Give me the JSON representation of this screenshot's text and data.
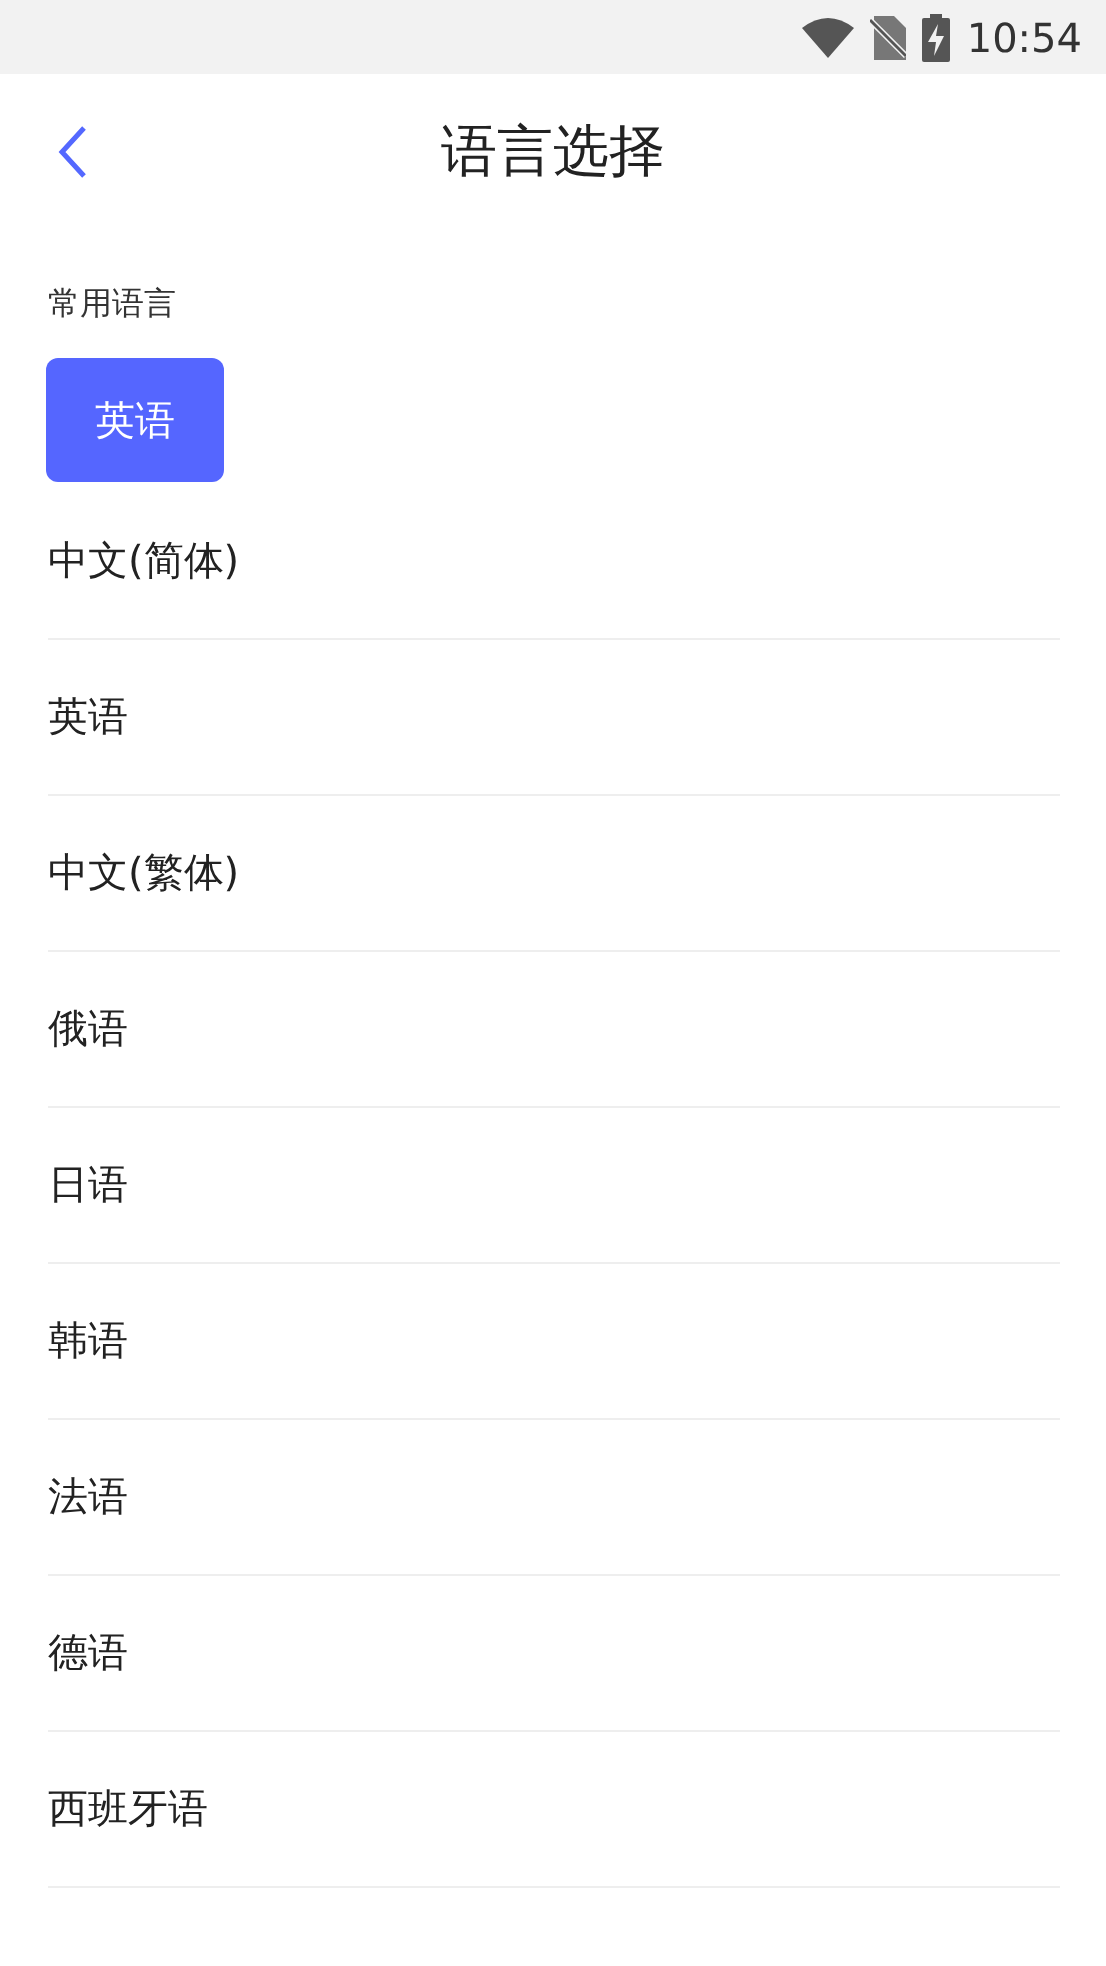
{
  "status_bar": {
    "time": "10:54"
  },
  "header": {
    "title": "语言选择"
  },
  "common": {
    "heading": "常用语言",
    "chips": [
      "英语"
    ]
  },
  "languages": [
    "中文(简体)",
    "英语",
    "中文(繁体)",
    "俄语",
    "日语",
    "韩语",
    "法语",
    "德语",
    "西班牙语"
  ]
}
